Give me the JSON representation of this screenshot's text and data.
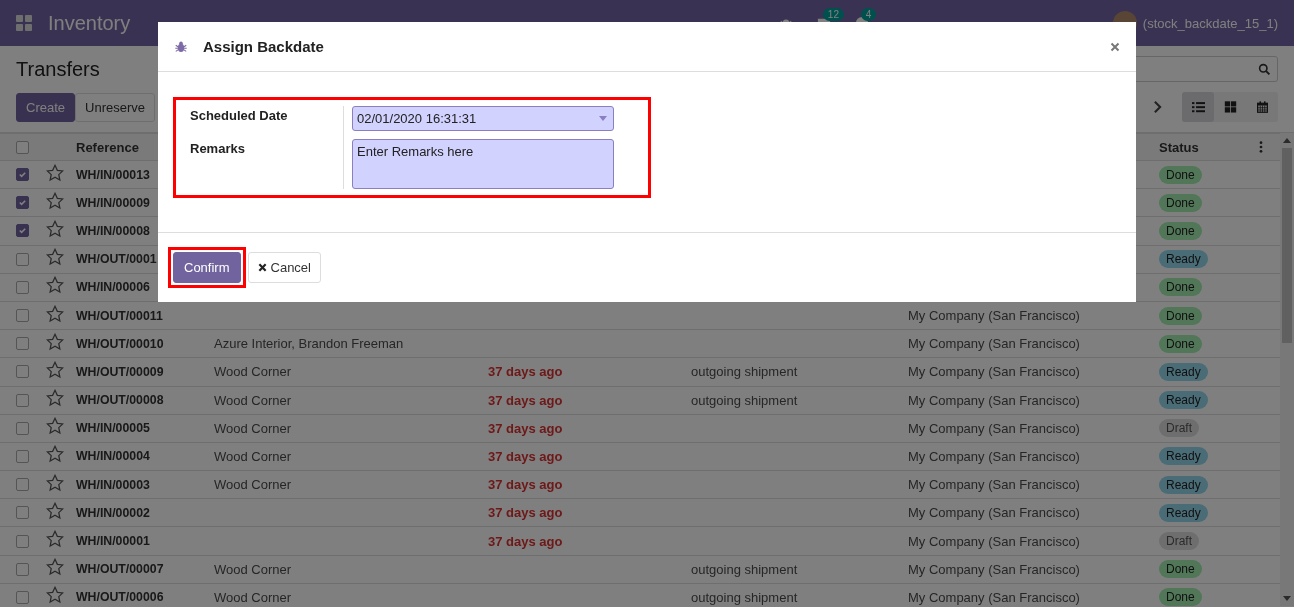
{
  "navbar": {
    "app_name": "Inventory",
    "chat_count": "12",
    "activity_count": "4",
    "user": "(stock_backdate_15_1)"
  },
  "control_panel": {
    "title": "Transfers",
    "buttons": [
      "Create",
      "Unreserve"
    ],
    "views": [
      {
        "kind": "list",
        "selected": true
      },
      {
        "kind": "kanban",
        "selected": false
      },
      {
        "kind": "calendar",
        "selected": false
      }
    ]
  },
  "table": {
    "all_selected": false,
    "columns": [
      "Reference",
      "Status"
    ],
    "rows": [
      {
        "checked": true,
        "starred": false,
        "reference": "WH/IN/00013",
        "status": {
          "kind": "done",
          "label": "Done"
        }
      },
      {
        "checked": true,
        "starred": false,
        "reference": "WH/IN/00009",
        "status": {
          "kind": "done",
          "label": "Done"
        }
      },
      {
        "checked": true,
        "starred": false,
        "reference": "WH/IN/00008",
        "status": {
          "kind": "done",
          "label": "Done"
        }
      },
      {
        "checked": false,
        "starred": false,
        "reference": "WH/OUT/0001",
        "status": {
          "kind": "ready",
          "label": "Ready"
        }
      },
      {
        "checked": false,
        "starred": false,
        "reference": "WH/IN/00006",
        "status": {
          "kind": "done",
          "label": "Done"
        }
      },
      {
        "checked": false,
        "starred": false,
        "reference": "WH/OUT/00011",
        "company": "My Company (San Francisco)",
        "status": {
          "kind": "done",
          "label": "Done"
        }
      },
      {
        "checked": false,
        "starred": false,
        "reference": "WH/OUT/00010",
        "contact": "Azure Interior, Brandon Freeman",
        "company": "My Company (San Francisco)",
        "status": {
          "kind": "done",
          "label": "Done"
        }
      },
      {
        "checked": false,
        "starred": false,
        "reference": "WH/OUT/00009",
        "contact": "Wood Corner",
        "scheduled": "37 days ago",
        "source": "outgoing shipment",
        "company": "My Company (San Francisco)",
        "status": {
          "kind": "ready",
          "label": "Ready"
        }
      },
      {
        "checked": false,
        "starred": false,
        "reference": "WH/OUT/00008",
        "contact": "Wood Corner",
        "scheduled": "37 days ago",
        "source": "outgoing shipment",
        "company": "My Company (San Francisco)",
        "status": {
          "kind": "ready",
          "label": "Ready"
        }
      },
      {
        "checked": false,
        "starred": false,
        "reference": "WH/IN/00005",
        "contact": "Wood Corner",
        "scheduled": "37 days ago",
        "company": "My Company (San Francisco)",
        "status": {
          "kind": "draft",
          "label": "Draft"
        }
      },
      {
        "checked": false,
        "starred": false,
        "reference": "WH/IN/00004",
        "contact": "Wood Corner",
        "scheduled": "37 days ago",
        "company": "My Company (San Francisco)",
        "status": {
          "kind": "ready",
          "label": "Ready"
        }
      },
      {
        "checked": false,
        "starred": false,
        "reference": "WH/IN/00003",
        "contact": "Wood Corner",
        "scheduled": "37 days ago",
        "company": "My Company (San Francisco)",
        "status": {
          "kind": "ready",
          "label": "Ready"
        }
      },
      {
        "checked": false,
        "starred": false,
        "reference": "WH/IN/00002",
        "scheduled": "37 days ago",
        "company": "My Company (San Francisco)",
        "status": {
          "kind": "ready",
          "label": "Ready"
        }
      },
      {
        "checked": false,
        "starred": false,
        "reference": "WH/IN/00001",
        "scheduled": "37 days ago",
        "company": "My Company (San Francisco)",
        "status": {
          "kind": "draft",
          "label": "Draft"
        }
      },
      {
        "checked": false,
        "starred": false,
        "reference": "WH/OUT/00007",
        "contact": "Wood Corner",
        "source": "outgoing shipment",
        "company": "My Company (San Francisco)",
        "status": {
          "kind": "done",
          "label": "Done"
        }
      },
      {
        "checked": false,
        "starred": false,
        "reference": "WH/OUT/00006",
        "contact": "Wood Corner",
        "source": "outgoing shipment",
        "company": "My Company (San Francisco)",
        "status": {
          "kind": "done",
          "label": "Done"
        }
      }
    ]
  },
  "dialog": {
    "title": "Assign Backdate",
    "fields": [
      {
        "kind": "date",
        "label": "Scheduled Date",
        "value": "02/01/2020 16:31:31"
      },
      {
        "kind": "text",
        "label": "Remarks",
        "value": "Enter Remarks here"
      }
    ],
    "confirm": "Confirm",
    "cancel": "Cancel"
  }
}
